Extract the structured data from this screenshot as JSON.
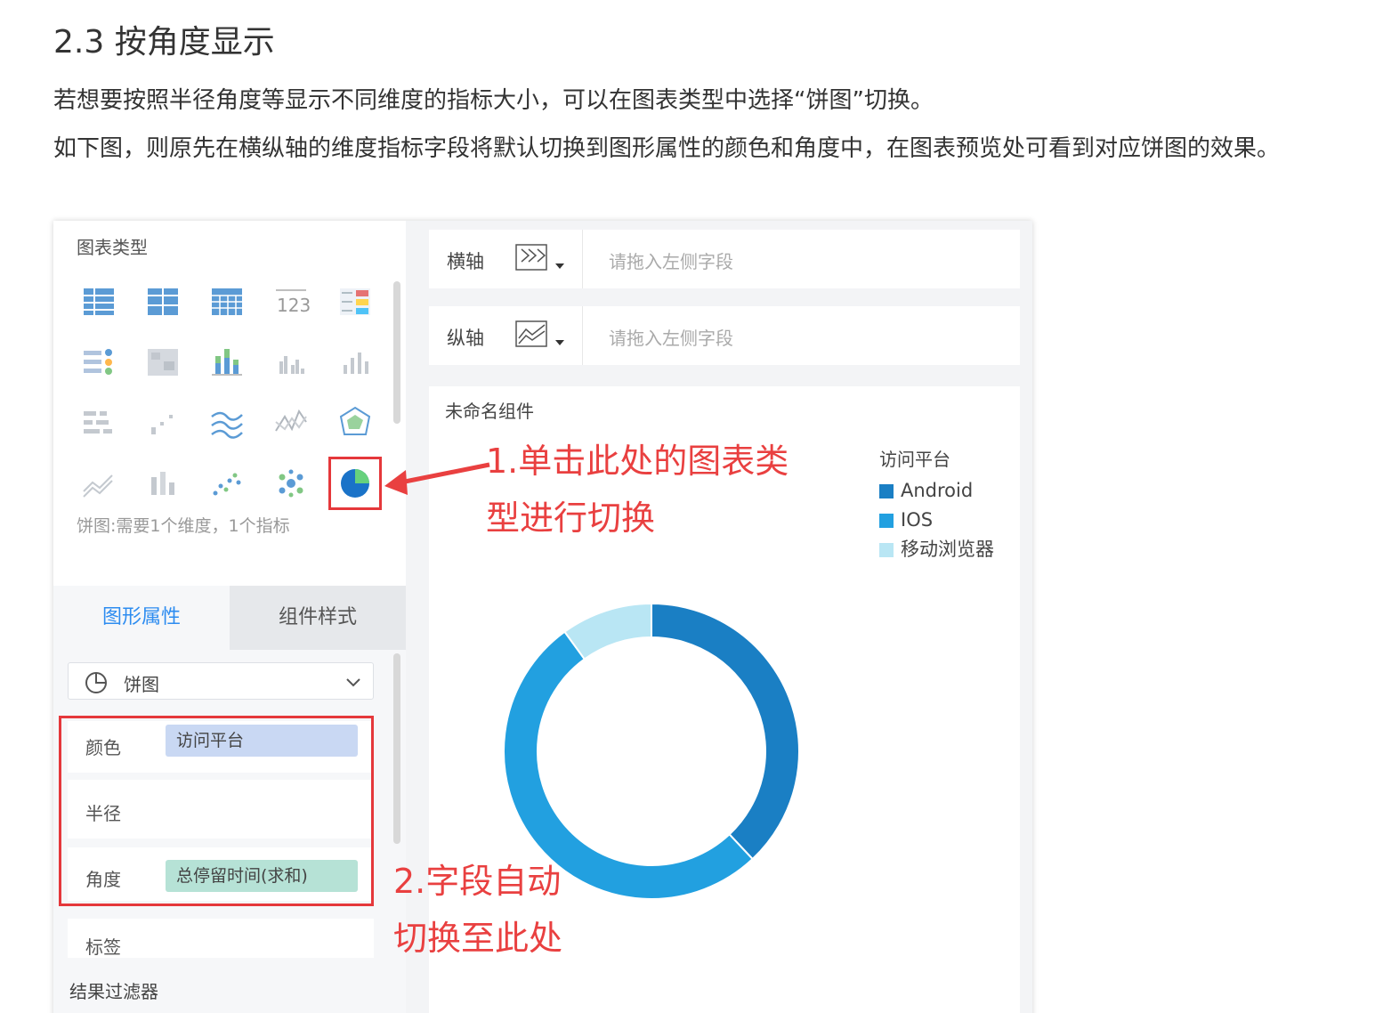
{
  "doc": {
    "title": "2.3 按角度显示",
    "para1": "若想要按照半径角度等显示不同维度的指标大小，可以在图表类型中选择“饼图”切换。",
    "para2": "如下图，则原先在横纵轴的维度指标字段将默认切换到图形属性的颜色和角度中，在图表预览处可看到对应饼图的效果。"
  },
  "left_panel": {
    "title": "图表类型",
    "chart_types": [
      "table-icon",
      "cross-table-icon",
      "detail-table-icon",
      "kpi-number-icon",
      "color-table-icon",
      "dot-matrix-icon",
      "heatmap-icon",
      "stacked-bar-icon",
      "grouped-bar-icon",
      "bar-icon",
      "horizontal-bar-icon",
      "scatter-small-icon",
      "multi-line-icon",
      "line-icon",
      "radar-icon",
      "area-icon",
      "stacked-column-icon",
      "scatter-icon",
      "bubble-icon",
      "pie-icon"
    ],
    "selected_chart": "pie-icon",
    "hint": "饼图:需要1个维度，1个指标",
    "tabs": [
      "图形属性",
      "组件样式"
    ],
    "active_tab": "图形属性",
    "chart_select": "饼图",
    "fields": {
      "color_label": "颜色",
      "color_value": "访问平台",
      "radius_label": "半径",
      "angle_label": "角度",
      "angle_value": "总停留时间(求和)",
      "tag_label": "标签"
    },
    "filter_title": "结果过滤器"
  },
  "right_panel": {
    "x_axis": {
      "label": "横轴",
      "placeholder": "请拖入左侧字段"
    },
    "y_axis": {
      "label": "纵轴",
      "placeholder": "请拖入左侧字段"
    },
    "card_title": "未命名组件"
  },
  "annotations": {
    "a1_line1": "1.单击此处的图表类",
    "a1_line2": "型进行切换",
    "a2_line1": "2.字段自动",
    "a2_line2": "切换至此处"
  },
  "colors": {
    "annotation_red": "#e94040",
    "tab_active_blue": "#2d8cf0"
  },
  "chart_data": {
    "type": "pie",
    "legend_title": "访问平台",
    "legend_position": "top-right",
    "categories": [
      "Android",
      "IOS",
      "移动浏览器"
    ],
    "values": [
      38,
      52,
      10
    ],
    "colors": [
      "#1a7fc4",
      "#22a0e0",
      "#b9e6f4"
    ]
  }
}
